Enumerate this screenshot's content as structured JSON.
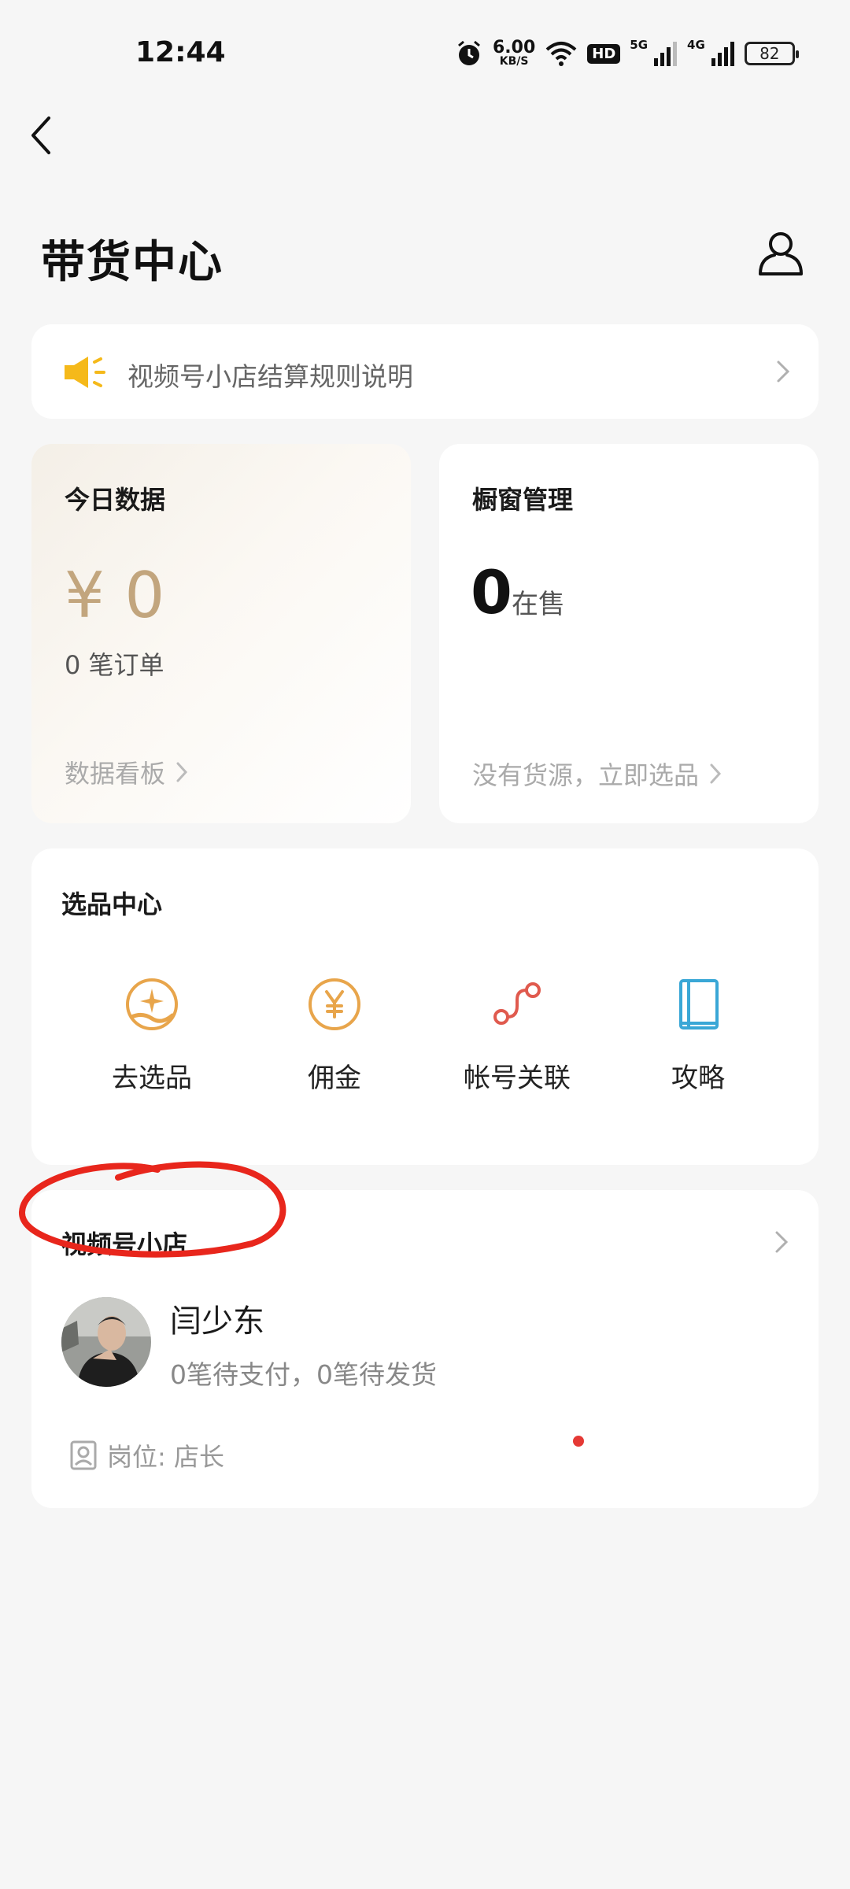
{
  "status_bar": {
    "time": "12:44",
    "net_speed_value": "6.00",
    "net_speed_unit": "KB/S",
    "hd_label": "HD",
    "sig1_label": "5G",
    "sig2_label": "4G",
    "battery": "82"
  },
  "header": {
    "title": "带货中心"
  },
  "notice": {
    "text": "视频号小店结算规则说明"
  },
  "today": {
    "title": "今日数据",
    "amount": "¥ 0",
    "orders": "0 笔订单",
    "link": "数据看板"
  },
  "window": {
    "title": "橱窗管理",
    "count": "0",
    "count_label": "在售",
    "link": "没有货源，立即选品"
  },
  "select_center": {
    "title": "选品中心",
    "items": [
      {
        "label": "去选品",
        "icon": "hand-sparkle-icon"
      },
      {
        "label": "佣金",
        "icon": "yen-icon"
      },
      {
        "label": "帐号关联",
        "icon": "link-path-icon"
      },
      {
        "label": "攻略",
        "icon": "book-icon"
      }
    ]
  },
  "shop": {
    "title": "视频号小店",
    "name": "闫少东",
    "status": "0笔待支付，0笔待发货",
    "role": "岗位: 店长"
  },
  "colors": {
    "accent_gold": "#c2a57d",
    "icon_orange": "#e8a54b",
    "icon_red": "#e05a4e",
    "icon_blue": "#3aa7d6",
    "annotation_red": "#e8261c"
  }
}
